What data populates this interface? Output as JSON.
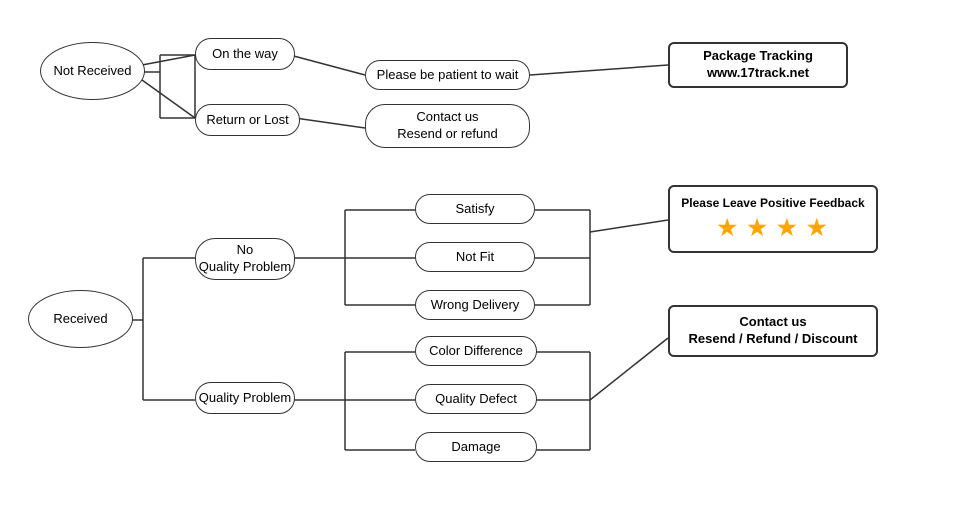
{
  "nodes": {
    "not_received": {
      "label": "Not\nReceived"
    },
    "on_the_way": {
      "label": "On the way"
    },
    "patient": {
      "label": "Please be patient to wait"
    },
    "tracking": {
      "label": "Package Tracking\nwww.17track.net"
    },
    "return_lost": {
      "label": "Return or Lost"
    },
    "contact_resend": {
      "label": "Contact us\nResend or refund"
    },
    "received": {
      "label": "Received"
    },
    "no_quality": {
      "label": "No\nQuality Problem"
    },
    "satisfy": {
      "label": "Satisfy"
    },
    "not_fit": {
      "label": "Not Fit"
    },
    "wrong_delivery": {
      "label": "Wrong Delivery"
    },
    "feedback": {
      "label": "Please Leave Positive Feedback",
      "stars": "★ ★ ★ ★"
    },
    "quality_problem": {
      "label": "Quality Problem"
    },
    "color_diff": {
      "label": "Color Difference"
    },
    "quality_defect": {
      "label": "Quality Defect"
    },
    "damage": {
      "label": "Damage"
    },
    "contact_refund": {
      "label": "Contact us\nResend / Refund / Discount"
    }
  }
}
